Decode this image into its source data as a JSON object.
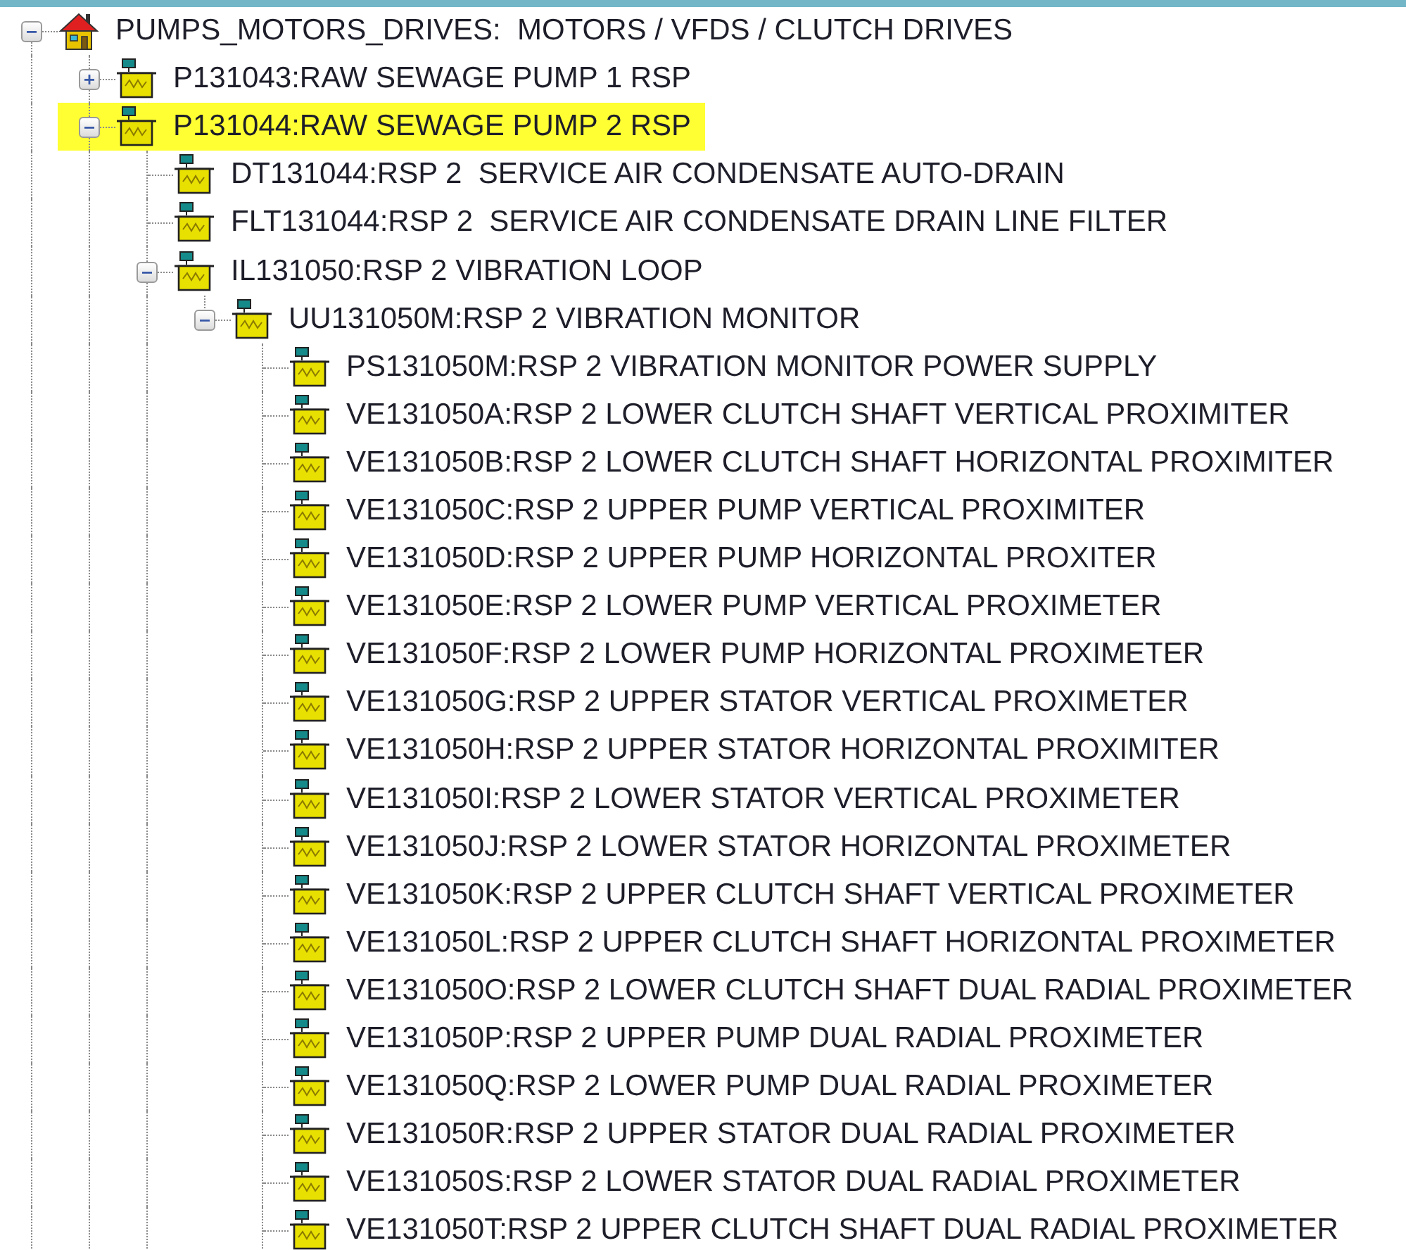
{
  "tree": {
    "root": {
      "label": "PUMPS_MOTORS_DRIVES:  MOTORS / VFDS / CLUTCH DRIVES",
      "kind": "house",
      "expanded": true,
      "selected": false,
      "more_siblings": true,
      "children": [
        {
          "label": "P131043:RAW SEWAGE PUMP 1 RSP",
          "kind": "device",
          "expanded": false,
          "selected": false,
          "more_siblings": true
        },
        {
          "label": "P131044:RAW SEWAGE PUMP 2 RSP",
          "kind": "device",
          "expanded": true,
          "selected": true,
          "more_siblings": true,
          "children": [
            {
              "label": "DT131044:RSP 2  SERVICE AIR CONDENSATE AUTO-DRAIN",
              "kind": "device",
              "selected": false,
              "more_siblings": true
            },
            {
              "label": "FLT131044:RSP 2  SERVICE AIR CONDENSATE DRAIN LINE FILTER",
              "kind": "device",
              "selected": false,
              "more_siblings": true
            },
            {
              "label": "IL131050:RSP 2 VIBRATION LOOP",
              "kind": "device",
              "expanded": true,
              "selected": false,
              "more_siblings": true,
              "children": [
                {
                  "label": "UU131050M:RSP 2 VIBRATION MONITOR",
                  "kind": "device",
                  "expanded": true,
                  "selected": false,
                  "more_siblings": false,
                  "children": [
                    {
                      "label": "PS131050M:RSP 2 VIBRATION MONITOR POWER SUPPLY",
                      "kind": "device",
                      "selected": false,
                      "more_siblings": true
                    },
                    {
                      "label": "VE131050A:RSP 2 LOWER CLUTCH SHAFT VERTICAL PROXIMITER",
                      "kind": "device",
                      "selected": false,
                      "more_siblings": true
                    },
                    {
                      "label": "VE131050B:RSP 2 LOWER CLUTCH SHAFT HORIZONTAL PROXIMITER",
                      "kind": "device",
                      "selected": false,
                      "more_siblings": true
                    },
                    {
                      "label": "VE131050C:RSP 2 UPPER PUMP VERTICAL PROXIMITER",
                      "kind": "device",
                      "selected": false,
                      "more_siblings": true
                    },
                    {
                      "label": "VE131050D:RSP 2 UPPER PUMP HORIZONTAL PROXITER",
                      "kind": "device",
                      "selected": false,
                      "more_siblings": true
                    },
                    {
                      "label": "VE131050E:RSP 2 LOWER PUMP VERTICAL PROXIMETER",
                      "kind": "device",
                      "selected": false,
                      "more_siblings": true
                    },
                    {
                      "label": "VE131050F:RSP 2 LOWER PUMP HORIZONTAL PROXIMETER",
                      "kind": "device",
                      "selected": false,
                      "more_siblings": true
                    },
                    {
                      "label": "VE131050G:RSP 2 UPPER STATOR VERTICAL PROXIMETER",
                      "kind": "device",
                      "selected": false,
                      "more_siblings": true
                    },
                    {
                      "label": "VE131050H:RSP 2 UPPER STATOR HORIZONTAL PROXIMITER",
                      "kind": "device",
                      "selected": false,
                      "more_siblings": true
                    },
                    {
                      "label": "VE131050I:RSP 2 LOWER STATOR VERTICAL PROXIMETER",
                      "kind": "device",
                      "selected": false,
                      "more_siblings": true
                    },
                    {
                      "label": "VE131050J:RSP 2 LOWER STATOR HORIZONTAL PROXIMETER",
                      "kind": "device",
                      "selected": false,
                      "more_siblings": true
                    },
                    {
                      "label": "VE131050K:RSP 2 UPPER CLUTCH SHAFT VERTICAL PROXIMETER",
                      "kind": "device",
                      "selected": false,
                      "more_siblings": true
                    },
                    {
                      "label": "VE131050L:RSP 2 UPPER CLUTCH SHAFT HORIZONTAL PROXIMETER",
                      "kind": "device",
                      "selected": false,
                      "more_siblings": true
                    },
                    {
                      "label": "VE131050O:RSP 2 LOWER CLUTCH SHAFT DUAL RADIAL PROXIMETER",
                      "kind": "device",
                      "selected": false,
                      "more_siblings": true
                    },
                    {
                      "label": "VE131050P:RSP 2 UPPER PUMP DUAL RADIAL PROXIMETER",
                      "kind": "device",
                      "selected": false,
                      "more_siblings": true
                    },
                    {
                      "label": "VE131050Q:RSP 2 LOWER PUMP DUAL RADIAL PROXIMETER",
                      "kind": "device",
                      "selected": false,
                      "more_siblings": true
                    },
                    {
                      "label": "VE131050R:RSP 2 UPPER STATOR DUAL RADIAL PROXIMETER",
                      "kind": "device",
                      "selected": false,
                      "more_siblings": true
                    },
                    {
                      "label": "VE131050S:RSP 2 LOWER STATOR DUAL RADIAL PROXIMETER",
                      "kind": "device",
                      "selected": false,
                      "more_siblings": true
                    },
                    {
                      "label": "VE131050T:RSP 2 UPPER CLUTCH SHAFT DUAL RADIAL PROXIMETER",
                      "kind": "device",
                      "selected": false,
                      "more_siblings": true
                    }
                  ]
                }
              ]
            }
          ]
        }
      ]
    }
  }
}
